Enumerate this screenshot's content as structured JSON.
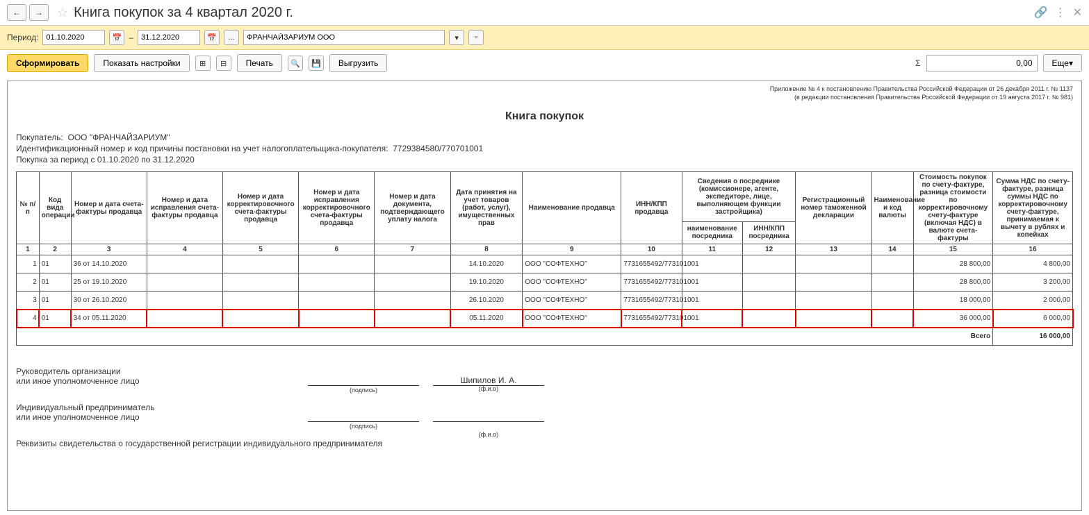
{
  "title": "Книга покупок за 4 квартал 2020 г.",
  "period": {
    "label": "Период:",
    "from": "01.10.2020",
    "sep": "–",
    "to": "31.12.2020",
    "dots": "...",
    "org": "ФРАНЧАЙЗАРИУМ ООО"
  },
  "toolbar": {
    "generate": "Сформировать",
    "settings": "Показать настройки",
    "print": "Печать",
    "export": "Выгрузить",
    "more": "Еще",
    "sigma": "Σ",
    "sum": "0,00"
  },
  "report": {
    "annotation1": "Приложение № 4 к постановлению Правительства Российской Федерации от 26 декабря 2011 г. № 1137",
    "annotation2": "(в редакции постановления Правительства Российской Федерации от 19 августа 2017 г. № 981)",
    "title": "Книга покупок",
    "buyer_label": "Покупатель:",
    "buyer": "ООО \"ФРАНЧАЙЗАРИУМ\"",
    "inn_label": "Идентификационный номер и код причины постановки на учет налогоплательщика-покупателя:",
    "inn": "7729384580/770701001",
    "period_label": "Покупка за период с 01.10.2020 по 31.12.2020"
  },
  "headers": {
    "c1": "№ п/п",
    "c2": "Код вида операции",
    "c3": "Номер и дата счета-фактуры продавца",
    "c4": "Номер и дата исправления счета-фактуры продавца",
    "c5": "Номер и дата корректировочного счета-фактуры продавца",
    "c6": "Номер и дата исправления корректировочного счета-фактуры продавца",
    "c7": "Номер и дата документа, подтверждающего уплату налога",
    "c8": "Дата принятия на учет товаров (работ, услуг), имущественных прав",
    "c9": "Наименование продавца",
    "c10": "ИНН/КПП продавца",
    "c11_12": "Сведения о посреднике (комиссионере, агенте, экспедиторе, лице, выполняющем функции застройщика)",
    "c11": "наименование посредника",
    "c12": "ИНН/КПП посредника",
    "c13": "Регистрационный номер таможенной декларации",
    "c14": "Наименование и код валюты",
    "c15": "Стоимость покупок по счету-фактуре, разница стоимости по корректировочному счету-фактуре (включая НДС) в валюте счета-фактуры",
    "c16": "Сумма НДС по счету-фактуре, разница суммы НДС по корректировочному счету-фактуре, принимаемая к вычету в рублях и копейках"
  },
  "colnums": [
    "1",
    "2",
    "3",
    "4",
    "5",
    "6",
    "7",
    "8",
    "9",
    "10",
    "11",
    "12",
    "13",
    "14",
    "15",
    "16"
  ],
  "rows": [
    {
      "n": "1",
      "code": "01",
      "inv": "36 от 14.10.2020",
      "date": "14.10.2020",
      "seller": "ООО \"СОФТЕХНО\"",
      "inn": "7731655492/773101001",
      "cost": "28 800,00",
      "vat": "4 800,00"
    },
    {
      "n": "2",
      "code": "01",
      "inv": "25 от 19.10.2020",
      "date": "19.10.2020",
      "seller": "ООО \"СОФТЕХНО\"",
      "inn": "7731655492/773101001",
      "cost": "28 800,00",
      "vat": "3 200,00"
    },
    {
      "n": "3",
      "code": "01",
      "inv": "30 от 26.10.2020",
      "date": "26.10.2020",
      "seller": "ООО \"СОФТЕХНО\"",
      "inn": "7731655492/773101001",
      "cost": "18 000,00",
      "vat": "2 000,00"
    },
    {
      "n": "4",
      "code": "01",
      "inv": "34 от 05.11.2020",
      "date": "05.11.2020",
      "seller": "ООО \"СОФТЕХНО\"",
      "inn": "7731655492/773101001",
      "cost": "36 000,00",
      "vat": "6 000,00",
      "highlight": true
    }
  ],
  "total": {
    "label": "Всего",
    "value": "16 000,00"
  },
  "sig": {
    "head1": "Руководитель организации",
    "head2": "или иное уполномоченное лицо",
    "name": "Шипилов И. А.",
    "sign": "(подпись)",
    "fio": "(ф.и.о)",
    "ip1": "Индивидуальный предприниматель",
    "ip2": "или иное уполномоченное лицо",
    "req": "Реквизиты свидетельства о государственной регистрации индивидуального предпринимателя"
  }
}
